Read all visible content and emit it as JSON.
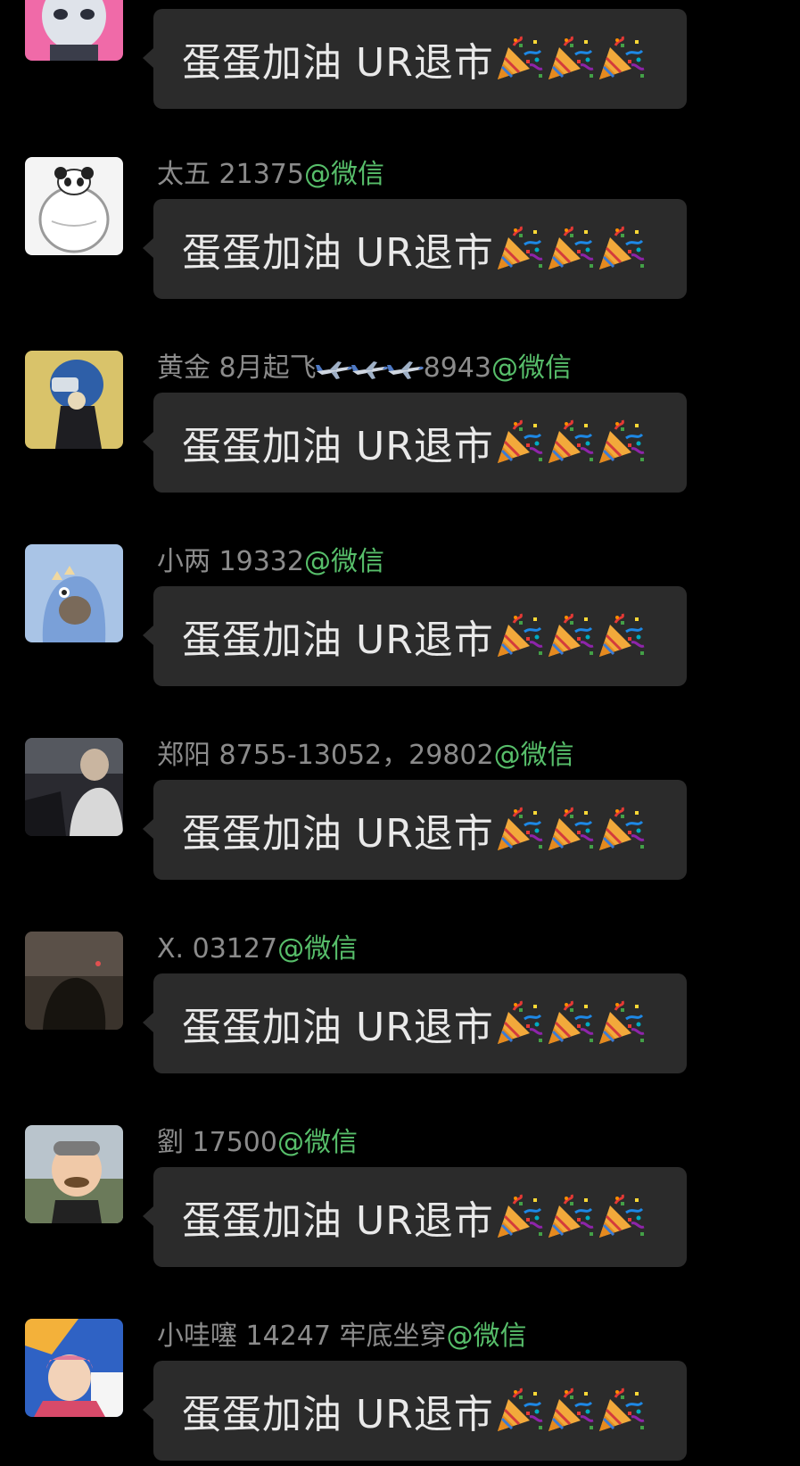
{
  "colors": {
    "background": "#000000",
    "bubble": "#2b2b2b",
    "sender_name": "#8b8b8b",
    "source_tag": "#57be6a",
    "message_text": "#e9e9e9"
  },
  "messages": [
    {
      "avatar_icon": "pink-cartoon-character-avatar",
      "sender": null,
      "source": null,
      "text": "蛋蛋加油 UR退市",
      "emoji": [
        "party-popper-icon",
        "party-popper-icon",
        "party-popper-icon"
      ]
    },
    {
      "avatar_icon": "panda-egg-avatar",
      "sender": "太五 21375",
      "source": "@微信",
      "text": "蛋蛋加油 UR退市",
      "emoji": [
        "party-popper-icon",
        "party-popper-icon",
        "party-popper-icon"
      ]
    },
    {
      "avatar_icon": "helmet-character-avatar",
      "sender": "黄金 8月起飞",
      "sender_suffix": "8943",
      "sender_emoji": [
        "airplane-icon",
        "airplane-icon",
        "airplane-icon"
      ],
      "source": "@微信",
      "text": "蛋蛋加油 UR退市",
      "emoji": [
        "party-popper-icon",
        "party-popper-icon",
        "party-popper-icon"
      ]
    },
    {
      "avatar_icon": "cartoon-dinosaur-avatar",
      "sender": "小两 19332",
      "source": "@微信",
      "text": "蛋蛋加油 UR退市",
      "emoji": [
        "party-popper-icon",
        "party-popper-icon",
        "party-popper-icon"
      ]
    },
    {
      "avatar_icon": "person-photo-avatar",
      "sender": "郑阳 8755-13052，29802",
      "source": "@微信",
      "text": "蛋蛋加油 UR退市",
      "emoji": [
        "party-popper-icon",
        "party-popper-icon",
        "party-popper-icon"
      ]
    },
    {
      "avatar_icon": "dark-photo-avatar",
      "sender": "X. 03127",
      "source": "@微信",
      "text": "蛋蛋加油 UR退市",
      "emoji": [
        "party-popper-icon",
        "party-popper-icon",
        "party-popper-icon"
      ]
    },
    {
      "avatar_icon": "baby-photo-avatar",
      "sender": "劉 17500",
      "source": "@微信",
      "text": "蛋蛋加油 UR退市",
      "emoji": [
        "party-popper-icon",
        "party-popper-icon",
        "party-popper-icon"
      ]
    },
    {
      "avatar_icon": "colorful-portrait-avatar",
      "sender": "小哇噻 14247 牢底坐穿",
      "source": "@微信",
      "text": "蛋蛋加油 UR退市",
      "emoji": [
        "party-popper-icon",
        "party-popper-icon",
        "party-popper-icon"
      ]
    }
  ]
}
